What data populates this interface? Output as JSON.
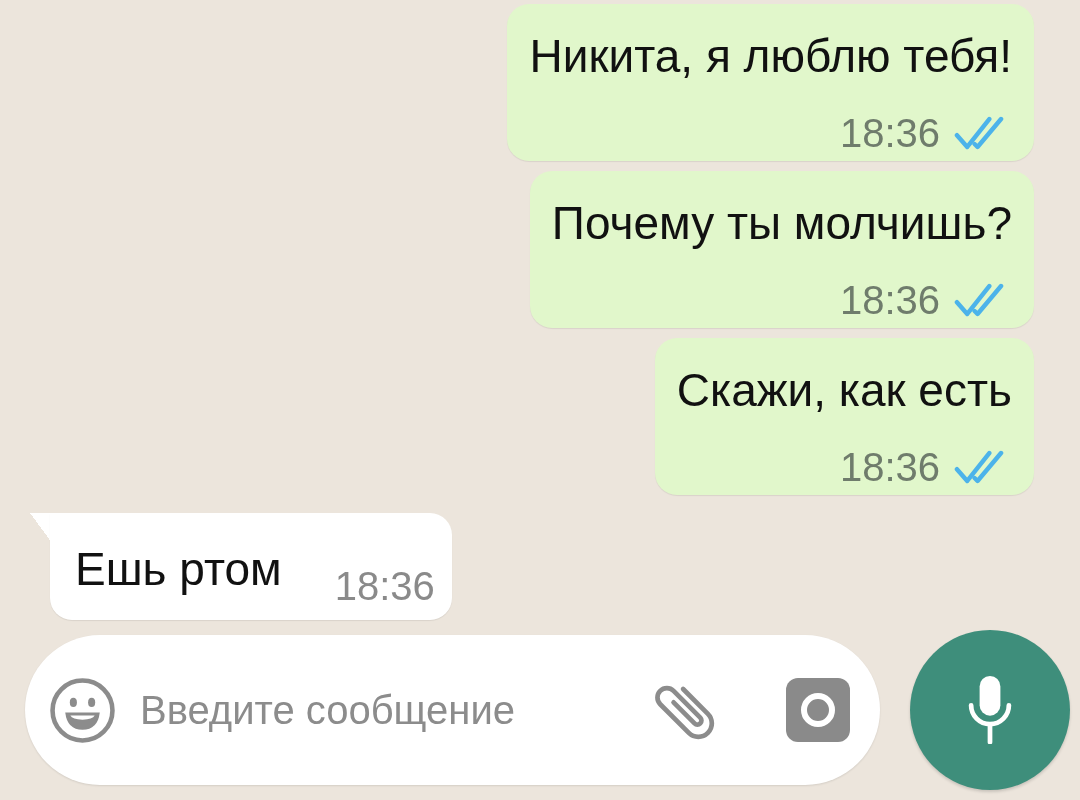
{
  "messages": [
    {
      "kind": "outgoing",
      "text": "Никита, я люблю тебя!",
      "time": "18:36",
      "read": true
    },
    {
      "kind": "outgoing",
      "text": "Почему ты молчишь?",
      "time": "18:36",
      "read": true
    },
    {
      "kind": "outgoing",
      "text": "Скажи, как есть",
      "time": "18:36",
      "read": true
    },
    {
      "kind": "incoming",
      "text": "Ешь ртом",
      "time": "18:36"
    }
  ],
  "composer": {
    "placeholder": "Введите сообщение"
  }
}
